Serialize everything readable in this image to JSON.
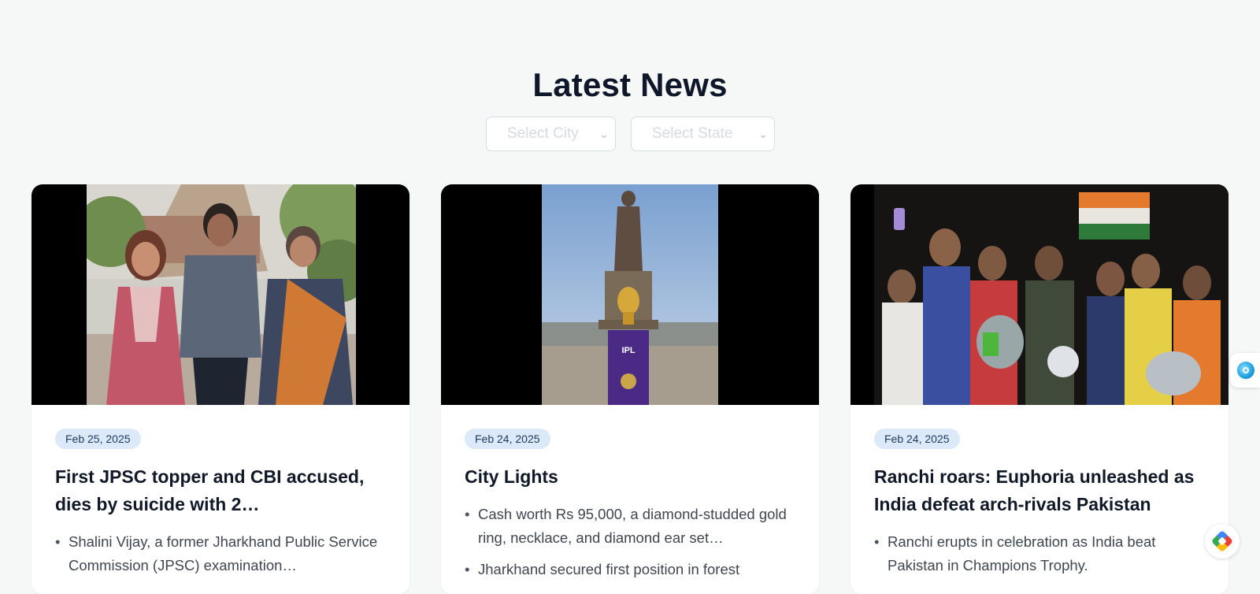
{
  "header": {
    "title": "Latest News"
  },
  "filters": {
    "city": {
      "placeholder": "Select City"
    },
    "state": {
      "placeholder": "Select State"
    }
  },
  "articles": [
    {
      "date": "Feb 25, 2025",
      "title": "First JPSC topper and CBI accused, dies by suicide with 2…",
      "bullets": [
        "Shalini Vijay, a former Jharkhand Public Service Commission (JPSC) examination…"
      ]
    },
    {
      "date": "Feb 24, 2025",
      "title": "City Lights",
      "bullets": [
        "Cash worth Rs 95,000, a diamond-studded gold ring, necklace, and diamond ear set…",
        "Jharkhand secured first position in forest"
      ],
      "image_text": {
        "brand": "IPL"
      }
    },
    {
      "date": "Feb 24, 2025",
      "title": "Ranchi roars: Euphoria unleashed as India defeat arch-rivals Pakistan",
      "bullets": [
        "Ranchi erupts in celebration as India beat Pakistan in Champions Trophy."
      ]
    }
  ],
  "icons": {
    "side_widget": "assistant-orb-icon",
    "fab": "gemini-diamond-icon",
    "select_chevron": "chevron-down-icon"
  },
  "colors": {
    "background": "#f6f8f7",
    "badge_bg": "#dbe9f9",
    "badge_text": "#1f3b5a",
    "title": "#0f172a"
  }
}
